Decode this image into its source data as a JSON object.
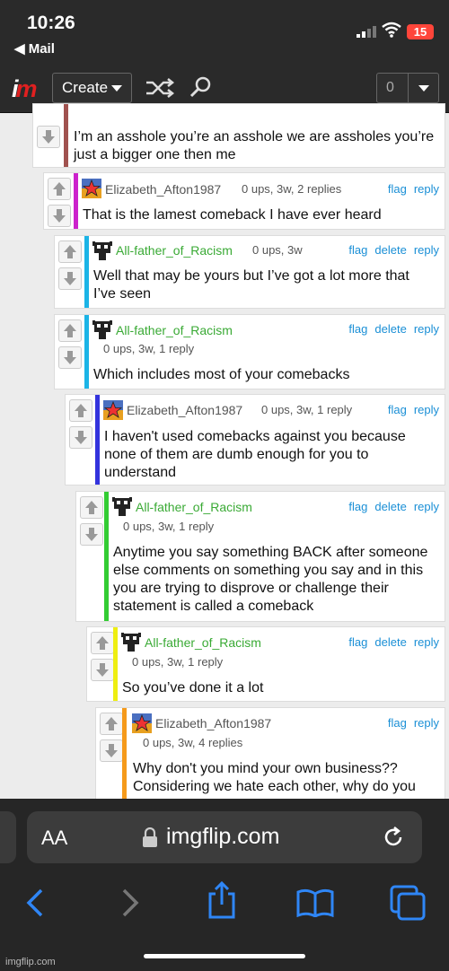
{
  "status": {
    "time": "10:26",
    "back_app": "◀ Mail",
    "battery": "15"
  },
  "nav": {
    "logo_i": "i",
    "logo_m": "m",
    "create_label": "Create",
    "notif_count": "0"
  },
  "comments": [
    {
      "user": "",
      "meta": "",
      "actions": [],
      "text": "I’m an asshole you’re an asshole we are assholes you’re just a bigger one then me"
    },
    {
      "user": "Elizabeth_Afton1987",
      "meta": "0 ups, 3w, 2 replies",
      "actions": [
        "flag",
        "reply"
      ],
      "text": "That is the lamest comeback I have ever heard"
    },
    {
      "user": "All-father_of_Racism",
      "meta": "0 ups, 3w",
      "actions": [
        "flag",
        "delete",
        "reply"
      ],
      "text": "Well that may be yours but I’ve got a lot more that I’ve seen"
    },
    {
      "user": "All-father_of_Racism",
      "meta": "0 ups, 3w, 1 reply",
      "actions": [
        "flag",
        "delete",
        "reply"
      ],
      "text": "Which includes most of your comebacks"
    },
    {
      "user": "Elizabeth_Afton1987",
      "meta": "0 ups, 3w, 1 reply",
      "actions": [
        "flag",
        "reply"
      ],
      "text": "I haven't used comebacks against you because none of them are dumb enough for you to understand"
    },
    {
      "user": "All-father_of_Racism",
      "meta": "0 ups, 3w, 1 reply",
      "actions": [
        "flag",
        "delete",
        "reply"
      ],
      "text": "Anytime you say something BACK after someone else comments on something you say and in this you are trying to disprove or challenge their statement is called a comeback"
    },
    {
      "user": "All-father_of_Racism",
      "meta": "0 ups, 3w, 1 reply",
      "actions": [
        "flag",
        "delete",
        "reply"
      ],
      "text": "So you’ve done it a lot"
    },
    {
      "user": "Elizabeth_Afton1987",
      "meta": "0 ups, 3w, 4 replies",
      "actions": [
        "flag",
        "reply"
      ],
      "text": "Why don't you mind your own business?? Considering we hate each other, why do you"
    }
  ],
  "colors": {
    "bar0": "#a0524f",
    "bar1": "#cc22cc",
    "bar2": "#1bb4e6",
    "bar3": "#1bb4e6",
    "bar4": "#3333dd",
    "bar5": "#33cc33",
    "bar6": "#eeee11",
    "bar7": "#f59a1b",
    "link": "#1a8fd6",
    "user_green": "#3aaa35"
  },
  "browser": {
    "aa_label": "AA",
    "domain": "imgflip.com"
  },
  "watermark": "imgflip.com"
}
